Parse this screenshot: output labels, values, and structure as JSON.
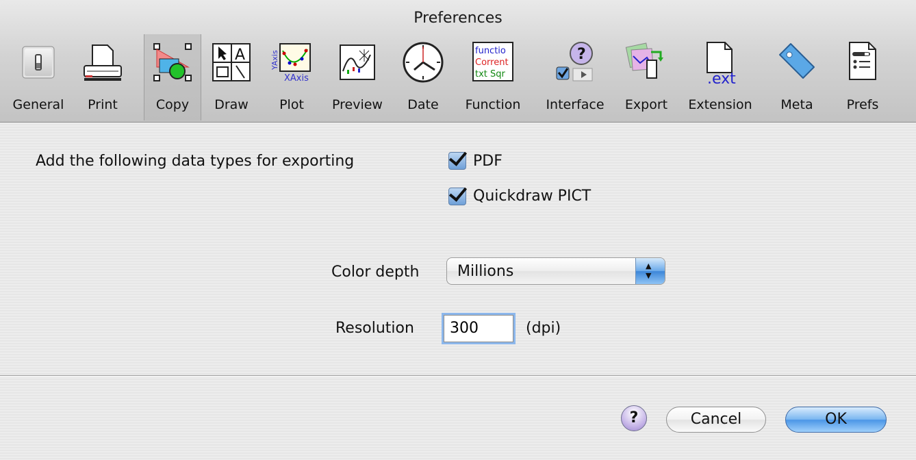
{
  "window": {
    "title": "Preferences"
  },
  "toolbar": {
    "items": [
      {
        "label": "General",
        "icon": "switch-icon"
      },
      {
        "label": "Print",
        "icon": "printer-icon"
      },
      {
        "label": "Copy",
        "icon": "shapes-icon",
        "selected": true
      },
      {
        "label": "Draw",
        "icon": "draw-tools-icon"
      },
      {
        "label": "Plot",
        "icon": "plot-icon",
        "icon_text_y": "YAxis",
        "icon_text_x": "XAxis"
      },
      {
        "label": "Preview",
        "icon": "preview-icon"
      },
      {
        "label": "Date",
        "icon": "clock-icon"
      },
      {
        "label": "Function",
        "icon": "function-icon",
        "icon_lines": [
          "functio",
          "Corrent",
          "txt Sqr"
        ]
      },
      {
        "label": "Interface",
        "icon": "interface-icon"
      },
      {
        "label": "Export",
        "icon": "export-icon"
      },
      {
        "label": "Extension",
        "icon": "extension-icon",
        "icon_text": ".ext"
      },
      {
        "label": "Meta",
        "icon": "tag-icon"
      },
      {
        "label": "Prefs",
        "icon": "prefs-icon"
      }
    ]
  },
  "content": {
    "export_label": "Add the following data types for exporting",
    "pdf_label": "PDF",
    "pdf_checked": true,
    "pict_label": "Quickdraw PICT",
    "pict_checked": true,
    "color_depth_label": "Color depth",
    "color_depth_value": "Millions",
    "resolution_label": "Resolution",
    "resolution_value": "300",
    "resolution_unit": "(dpi)"
  },
  "buttons": {
    "help": "?",
    "cancel": "Cancel",
    "ok": "OK"
  },
  "colors": {
    "accent": "#4a95e6",
    "toolbar_selected": "#c1c1c1"
  }
}
